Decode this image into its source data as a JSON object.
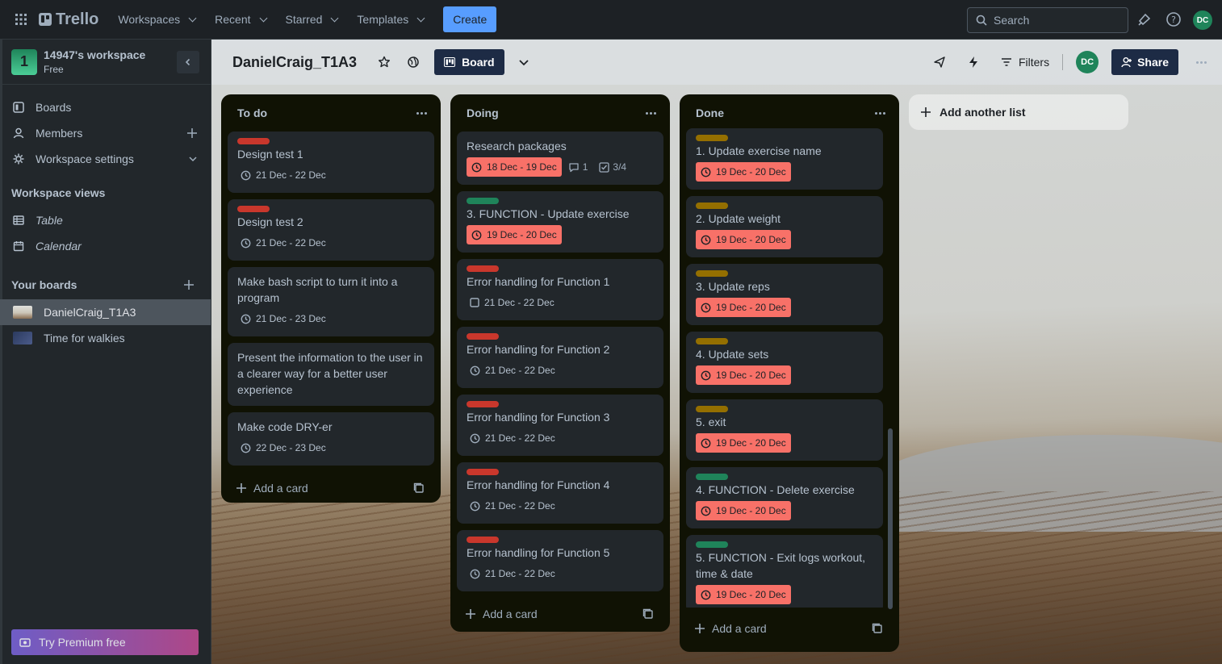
{
  "topnav": {
    "app_name": "Trello",
    "menus": [
      "Workspaces",
      "Recent",
      "Starred",
      "Templates"
    ],
    "create_label": "Create",
    "search_placeholder": "Search",
    "avatar_initials": "DC"
  },
  "sidebar": {
    "workspace_initial": "1",
    "workspace_name": "14947's workspace",
    "workspace_plan": "Free",
    "items": [
      {
        "label": "Boards",
        "icon": "board-icon"
      },
      {
        "label": "Members",
        "icon": "person-icon"
      },
      {
        "label": "Workspace settings",
        "icon": "gear-icon"
      }
    ],
    "views_heading": "Workspace views",
    "views": [
      {
        "label": "Table",
        "icon": "table-icon"
      },
      {
        "label": "Calendar",
        "icon": "calendar-icon"
      }
    ],
    "boards_heading": "Your boards",
    "boards": [
      {
        "label": "DanielCraig_T1A3",
        "active": true
      },
      {
        "label": "Time for walkies",
        "active": false
      }
    ],
    "premium_label": "Try Premium free"
  },
  "board": {
    "title": "DanielCraig_T1A3",
    "view_label": "Board",
    "filters_label": "Filters",
    "member_initials": "DC",
    "share_label": "Share",
    "add_list_label": "Add another list"
  },
  "lists": [
    {
      "title": "To do",
      "add_label": "Add a card",
      "cards": [
        {
          "title": "Design test 1",
          "label_color": "#c9372c",
          "date": "21 Dec - 22 Dec"
        },
        {
          "title": "Design test 2",
          "label_color": "#c9372c",
          "date": "21 Dec - 22 Dec"
        },
        {
          "title": "Make bash script to turn it into a program",
          "date": "21 Dec - 23 Dec"
        },
        {
          "title": "Present the information to the user in a clearer way for a better user experience"
        },
        {
          "title": "Make code DRY-er",
          "date": "22 Dec - 23 Dec"
        }
      ]
    },
    {
      "title": "Doing",
      "add_label": "Add a card",
      "cards": [
        {
          "title": "Research packages",
          "date": "18 Dec - 19 Dec",
          "overdue": true,
          "comments": "1",
          "checklist": "3/4"
        },
        {
          "title": "3. FUNCTION - Update exercise",
          "label_color": "#1f845a",
          "date": "19 Dec - 20 Dec",
          "overdue": true
        },
        {
          "title": "Error handling for Function 1",
          "label_color": "#c9372c",
          "date": "21 Dec - 22 Dec",
          "checkbox": true
        },
        {
          "title": "Error handling for Function 2",
          "label_color": "#c9372c",
          "date": "21 Dec - 22 Dec"
        },
        {
          "title": "Error handling for Function 3",
          "label_color": "#c9372c",
          "date": "21 Dec - 22 Dec"
        },
        {
          "title": "Error handling for Function 4",
          "label_color": "#c9372c",
          "date": "21 Dec - 22 Dec"
        },
        {
          "title": "Error handling for Function 5",
          "label_color": "#c9372c",
          "date": "21 Dec - 22 Dec"
        }
      ]
    },
    {
      "title": "Done",
      "add_label": "Add a card",
      "cards": [
        {
          "title": "1. Update exercise name",
          "label_color": "#946f00",
          "date": "19 Dec - 20 Dec",
          "overdue": true
        },
        {
          "title": "2. Update weight",
          "label_color": "#946f00",
          "date": "19 Dec - 20 Dec",
          "overdue": true
        },
        {
          "title": "3. Update reps",
          "label_color": "#946f00",
          "date": "19 Dec - 20 Dec",
          "overdue": true
        },
        {
          "title": "4. Update sets",
          "label_color": "#946f00",
          "date": "19 Dec - 20 Dec",
          "overdue": true
        },
        {
          "title": "5. exit",
          "label_color": "#946f00",
          "date": "19 Dec - 20 Dec",
          "overdue": true
        },
        {
          "title": "4. FUNCTION - Delete exercise",
          "label_color": "#1f845a",
          "date": "19 Dec - 20 Dec",
          "overdue": true
        },
        {
          "title": "5. FUNCTION - Exit logs workout, time & date",
          "label_color": "#1f845a",
          "date": "19 Dec - 20 Dec",
          "overdue": true
        }
      ]
    }
  ],
  "colors": {
    "nav_bg": "#1d2125",
    "sidebar_bg": "#22272b",
    "list_bg": "#101204",
    "card_bg": "#22272b",
    "accent": "#579dff",
    "overdue": "#f87168",
    "board_header": "#1d2b45"
  }
}
